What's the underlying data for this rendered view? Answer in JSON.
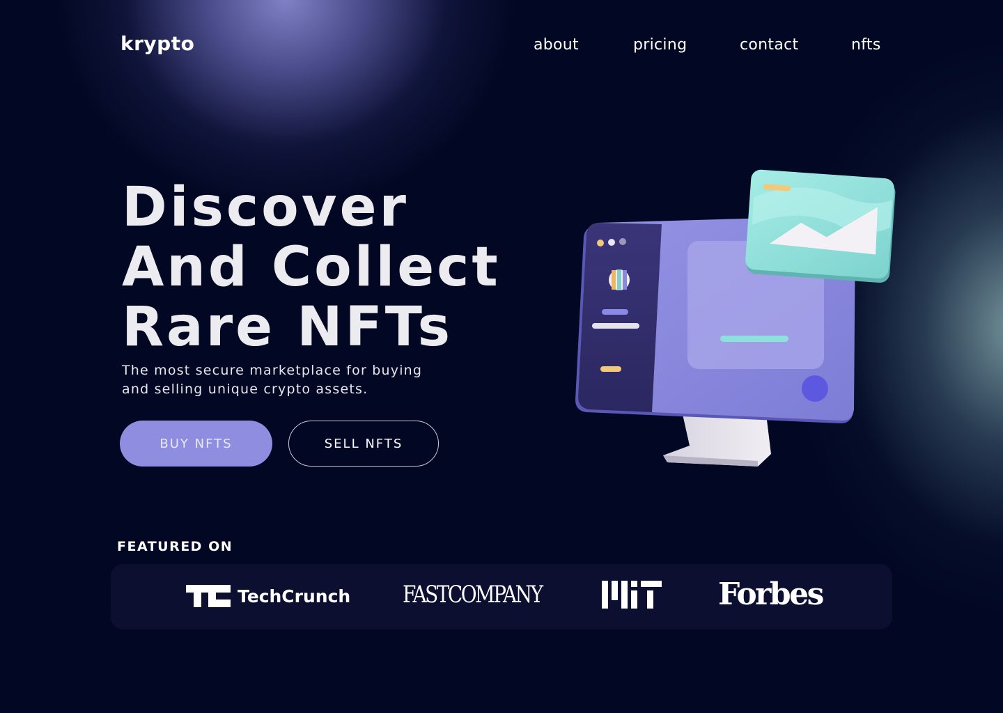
{
  "header": {
    "logo": "krypto",
    "nav": [
      "about",
      "pricing",
      "contact",
      "nfts"
    ]
  },
  "hero": {
    "title_lines": [
      "Discover",
      "And Collect",
      "Rare NFTs"
    ],
    "subtitle": "The most secure marketplace for buying and selling unique crypto assets.",
    "buy_label": "BUY NFTS",
    "sell_label": "SELL NFTS"
  },
  "featured": {
    "label": "FEATURED ON",
    "brands": [
      "TechCrunch",
      "FASTCOMPANY",
      "MIT",
      "Forbes"
    ]
  },
  "colors": {
    "background": "#020823",
    "accent": "#8e8de0",
    "featured_bar": "#0d0f31",
    "monitor_screen": "#8180d8",
    "card_teal": "#8ee0dc"
  }
}
